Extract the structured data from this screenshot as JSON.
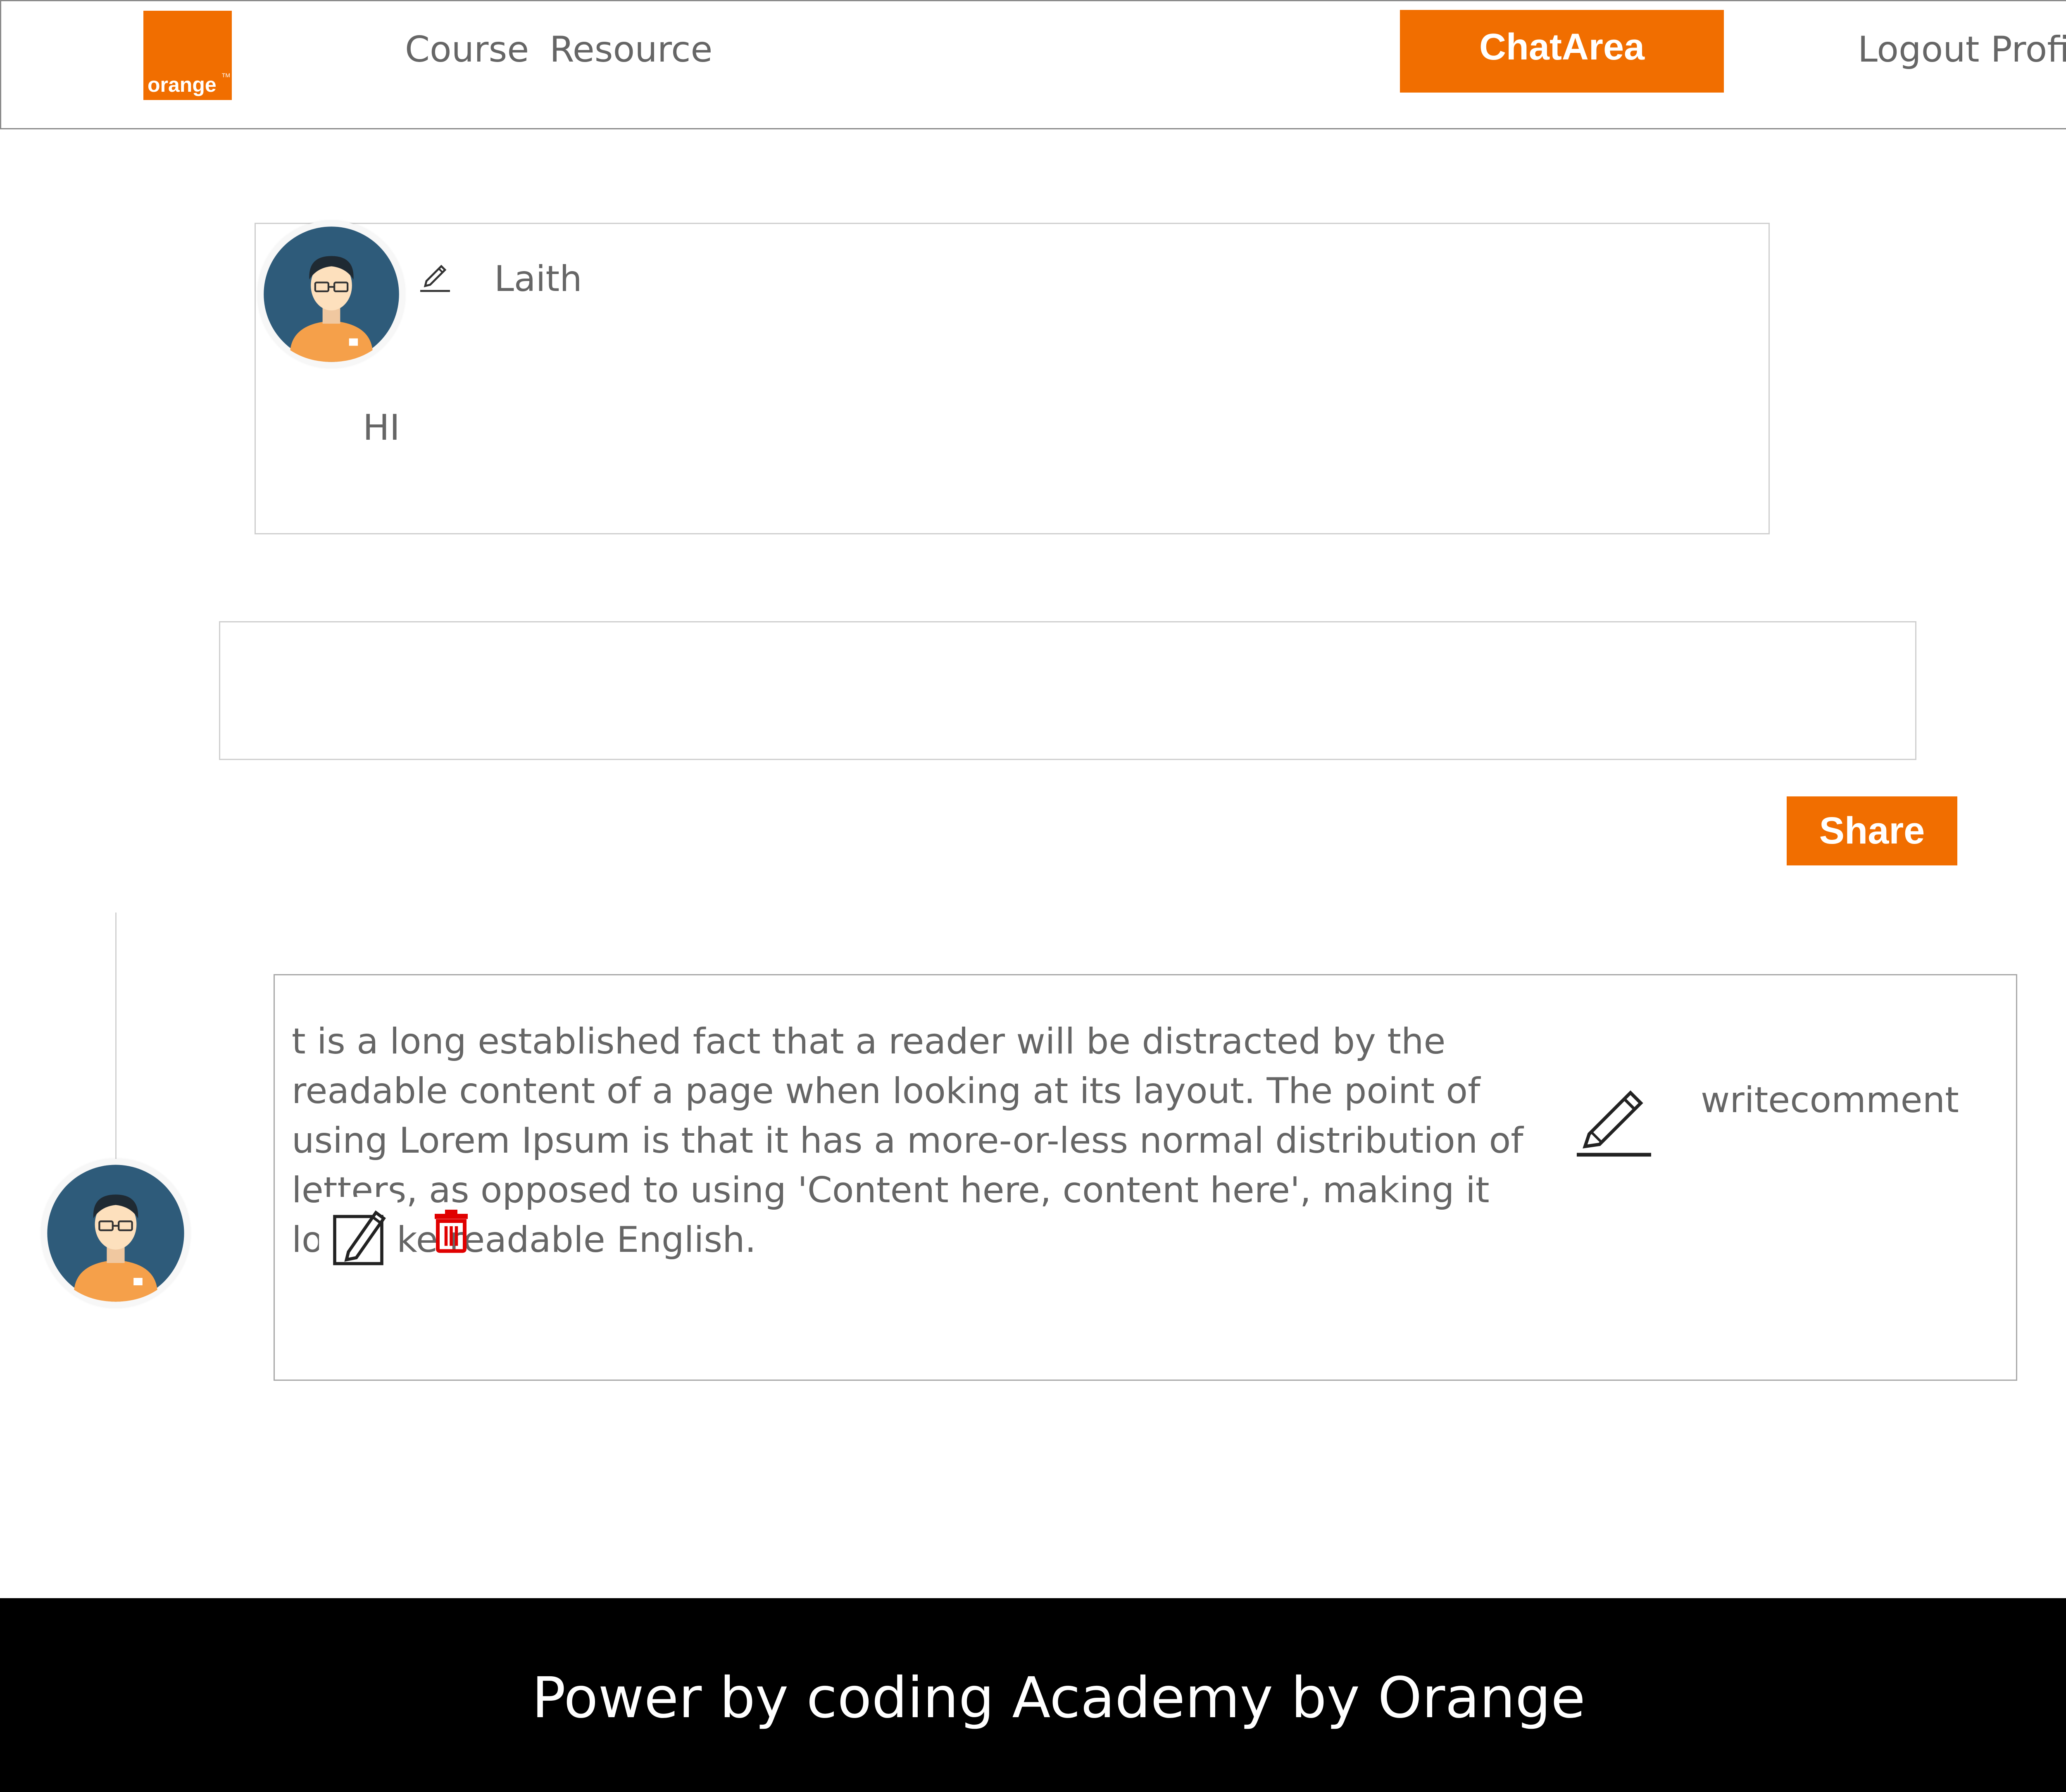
{
  "header": {
    "logo_text": "orange",
    "logo_tm": "TM",
    "nav": [
      "Course",
      "Resource"
    ],
    "chat_button": "ChatArea",
    "right_links": "Logout Profile"
  },
  "post": {
    "author": "Laith",
    "text": "HI"
  },
  "composer": {
    "value": "",
    "share_label": "Share"
  },
  "comment": {
    "text": "t is a long established fact that a reader will be distracted by the readable content of a page when looking at its layout. The point of using Lorem Ipsum is that it has a more-or-less normal distribution of letters, as opposed to using 'Content here, content here', making it look like readable English.",
    "write_label": "writecomment"
  },
  "footer": {
    "text": "Power by coding Academy by Orange"
  },
  "colors": {
    "brand": "#f16e00",
    "footer_bg": "#000000",
    "delete": "#e00000"
  },
  "icons": [
    "avatar",
    "pencil-icon",
    "edit-icon",
    "trash-icon"
  ]
}
